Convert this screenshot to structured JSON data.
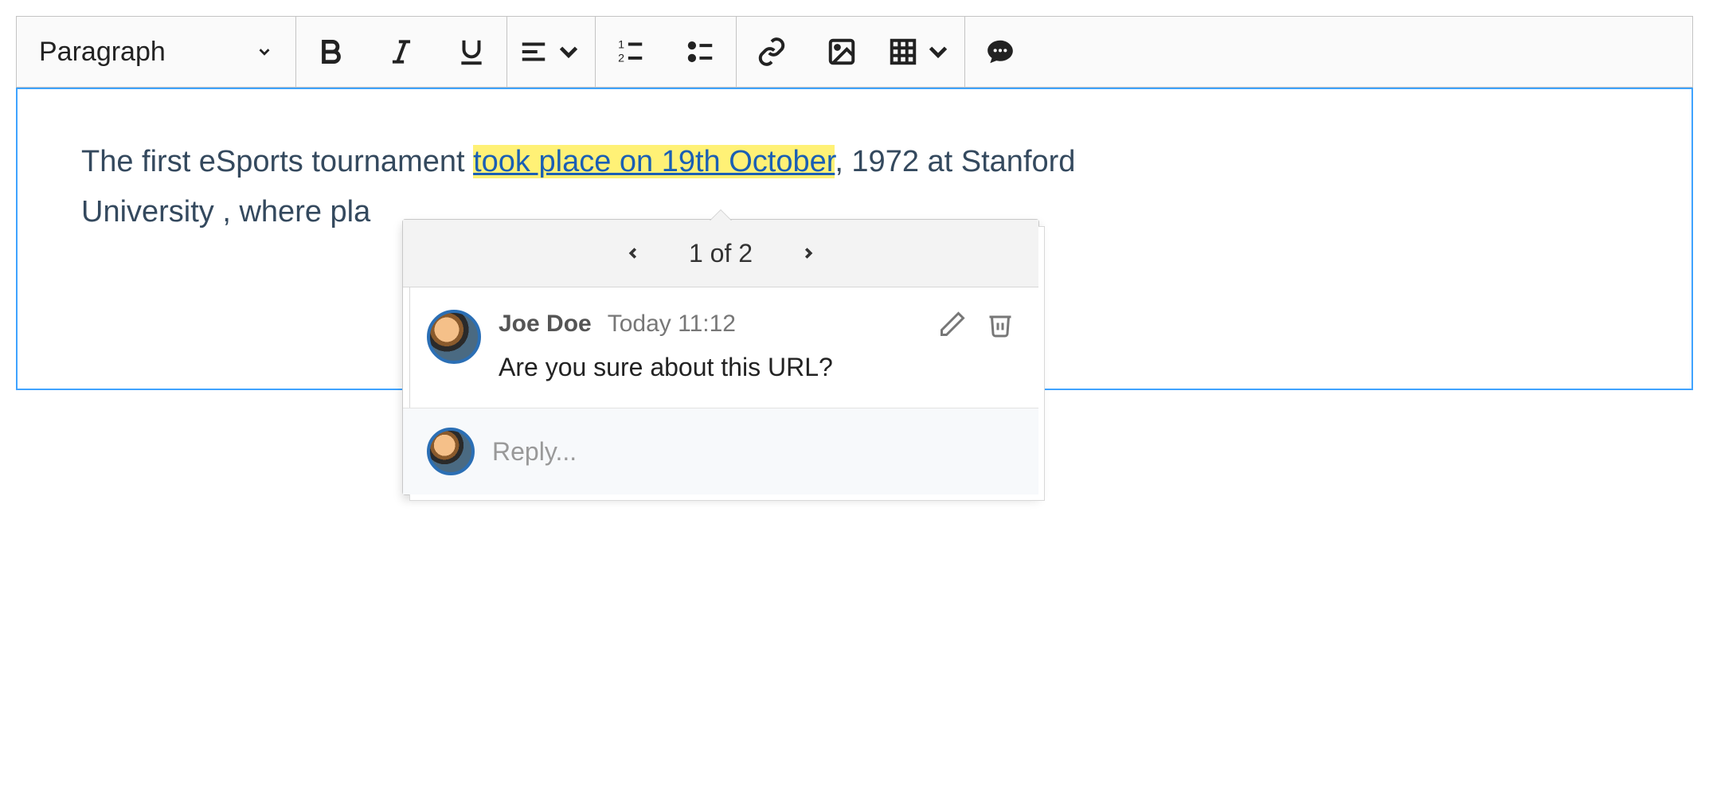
{
  "toolbar": {
    "heading_label": "Paragraph"
  },
  "content": {
    "before": "The first eSports tournament ",
    "highlight": "took place on 19th October",
    "after_line1": ", 1972 at Stanford",
    "line2_visible": "University , where pla"
  },
  "popup": {
    "pager": "1 of 2",
    "comment": {
      "author": "Joe Doe",
      "time": "Today 11:12",
      "text": "Are you sure about this URL?"
    },
    "reply_placeholder": "Reply..."
  }
}
